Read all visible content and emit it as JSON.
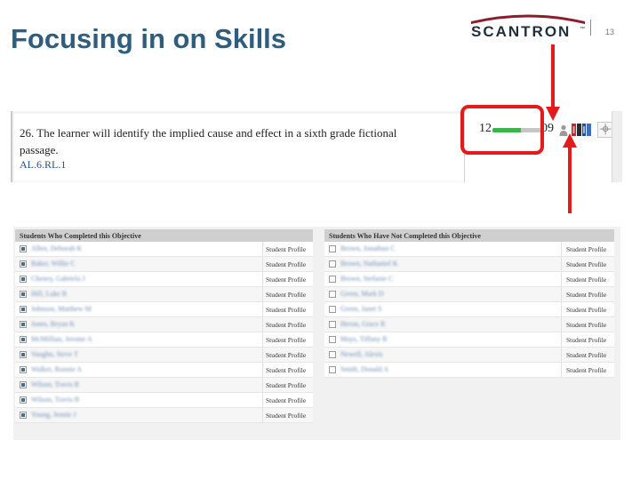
{
  "slide": {
    "title": "Focusing in on Skills",
    "page_number": "13"
  },
  "brand": {
    "logo_text": "SCANTRON",
    "logo_tm": "™",
    "title_color": "#2e5d7d",
    "accent_red": "#e41b1b",
    "progress_green": "#39b54a"
  },
  "objective": {
    "text": "26. The learner will identify the implied cause and effect in a sixth grade fictional passage.",
    "code": "AL.6.RL.1",
    "completed_count": "12",
    "not_completed_count": "09",
    "progress_fraction": 0.57,
    "icons": [
      "person-icon",
      "book-icon",
      "target-icon"
    ]
  },
  "completed_list": {
    "header": "Students Who Completed this Objective",
    "link_label": "Student Profile",
    "students": [
      {
        "name": "Allen, Deborah K"
      },
      {
        "name": "Baker, Willie C"
      },
      {
        "name": "Cheney, Gabriela J"
      },
      {
        "name": "Hill, Luke R"
      },
      {
        "name": "Johnson, Matthew M"
      },
      {
        "name": "Jones, Bryan K"
      },
      {
        "name": "McMillian, Jerome A"
      },
      {
        "name": "Vaughn, Steve T"
      },
      {
        "name": "Walker, Ronnie A"
      },
      {
        "name": "Wilson, Travis R"
      },
      {
        "name": "Wilson, Travis B"
      },
      {
        "name": "Young, Jennie J"
      }
    ]
  },
  "not_completed_list": {
    "header": "Students Who Have Not Completed this Objective",
    "link_label": "Student Profile",
    "students": [
      {
        "name": "Brown, Jonathan C"
      },
      {
        "name": "Brown, Nathaniel K"
      },
      {
        "name": "Brown, Stefanie C"
      },
      {
        "name": "Green, Mark D"
      },
      {
        "name": "Green, Janet S"
      },
      {
        "name": "Heron, Grace R"
      },
      {
        "name": "Mays, Tiffany R"
      },
      {
        "name": "Newell, Alexis"
      },
      {
        "name": "Smith, Donald A"
      }
    ]
  }
}
